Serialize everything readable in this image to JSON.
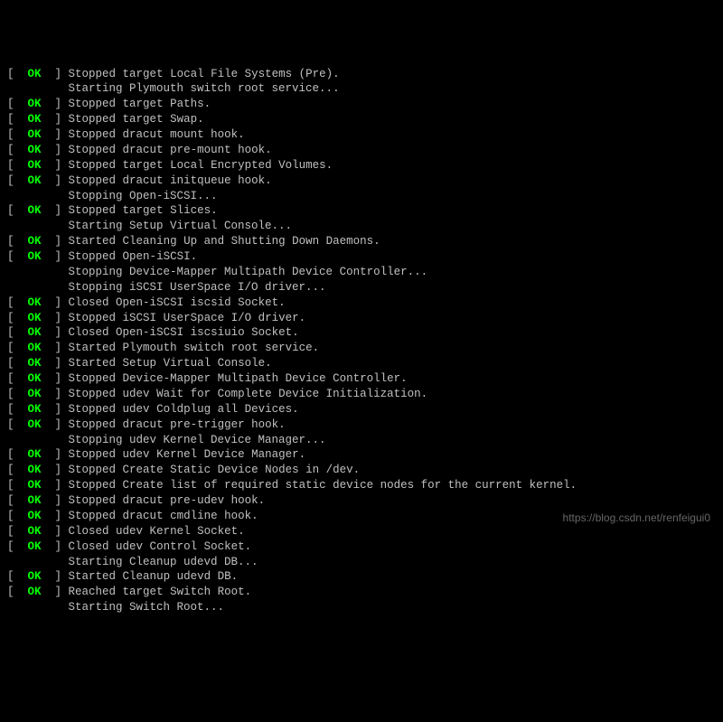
{
  "terminal": {
    "lines": [
      {
        "status": "OK",
        "text": "Stopped target Local File Systems (Pre)."
      },
      {
        "status": null,
        "text": "Starting Plymouth switch root service..."
      },
      {
        "status": "OK",
        "text": "Stopped target Paths."
      },
      {
        "status": "OK",
        "text": "Stopped target Swap."
      },
      {
        "status": "OK",
        "text": "Stopped dracut mount hook."
      },
      {
        "status": "OK",
        "text": "Stopped dracut pre-mount hook."
      },
      {
        "status": "OK",
        "text": "Stopped target Local Encrypted Volumes."
      },
      {
        "status": "OK",
        "text": "Stopped dracut initqueue hook."
      },
      {
        "status": null,
        "text": "Stopping Open-iSCSI..."
      },
      {
        "status": "OK",
        "text": "Stopped target Slices."
      },
      {
        "status": null,
        "text": "Starting Setup Virtual Console..."
      },
      {
        "status": "OK",
        "text": "Started Cleaning Up and Shutting Down Daemons."
      },
      {
        "status": "OK",
        "text": "Stopped Open-iSCSI."
      },
      {
        "status": null,
        "text": "Stopping Device-Mapper Multipath Device Controller..."
      },
      {
        "status": null,
        "text": "Stopping iSCSI UserSpace I/O driver..."
      },
      {
        "status": "OK",
        "text": "Closed Open-iSCSI iscsid Socket."
      },
      {
        "status": "OK",
        "text": "Stopped iSCSI UserSpace I/O driver."
      },
      {
        "status": "OK",
        "text": "Closed Open-iSCSI iscsiuio Socket."
      },
      {
        "status": "OK",
        "text": "Started Plymouth switch root service."
      },
      {
        "status": "OK",
        "text": "Started Setup Virtual Console."
      },
      {
        "status": "OK",
        "text": "Stopped Device-Mapper Multipath Device Controller."
      },
      {
        "status": "OK",
        "text": "Stopped udev Wait for Complete Device Initialization."
      },
      {
        "status": "OK",
        "text": "Stopped udev Coldplug all Devices."
      },
      {
        "status": "OK",
        "text": "Stopped dracut pre-trigger hook."
      },
      {
        "status": null,
        "text": "Stopping udev Kernel Device Manager..."
      },
      {
        "status": "OK",
        "text": "Stopped udev Kernel Device Manager."
      },
      {
        "status": "OK",
        "text": "Stopped Create Static Device Nodes in /dev."
      },
      {
        "status": "OK",
        "text": "Stopped Create list of required static device nodes for the current kernel."
      },
      {
        "status": "OK",
        "text": "Stopped dracut pre-udev hook."
      },
      {
        "status": "OK",
        "text": "Stopped dracut cmdline hook."
      },
      {
        "status": "OK",
        "text": "Closed udev Kernel Socket."
      },
      {
        "status": "OK",
        "text": "Closed udev Control Socket."
      },
      {
        "status": null,
        "text": "Starting Cleanup udevd DB..."
      },
      {
        "status": "OK",
        "text": "Started Cleanup udevd DB."
      },
      {
        "status": "OK",
        "text": "Reached target Switch Root."
      },
      {
        "status": null,
        "text": "Starting Switch Root..."
      }
    ]
  },
  "watermark": "https://blog.csdn.net/renfeigui0"
}
